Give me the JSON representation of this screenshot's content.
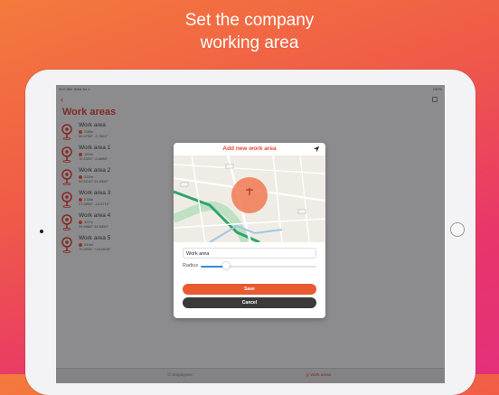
{
  "headline": {
    "line1": "Set the company",
    "line2": "working area"
  },
  "status_bar": {
    "time": "9:07 AM",
    "date": "Wed Jul 1",
    "battery": "100%"
  },
  "nav": {
    "back_glyph": "‹",
    "title": "Work areas"
  },
  "work_areas": [
    {
      "name": "Work area",
      "radius": "208m",
      "coords": "50.4758° -2.7824°"
    },
    {
      "name": "Work area 1",
      "radius": "150m",
      "coords": "12.6339° -0.6886°"
    },
    {
      "name": "Work area 2",
      "radius": "223m",
      "coords": "50.6215° 34.8955°"
    },
    {
      "name": "Work area 3",
      "radius": "218m",
      "coords": "27.8854° -15.5710°"
    },
    {
      "name": "Work area 4",
      "radius": "407m",
      "coords": "34.9968° 34.8959°"
    },
    {
      "name": "Work area 5",
      "radius": "243m",
      "coords": "70.3938° +43.0508°"
    }
  ],
  "tabbar": {
    "tab1": "Employees",
    "tab2": "Work areas"
  },
  "modal": {
    "title": "Add new work area",
    "name_value": "Work area",
    "radius_label": "Radius",
    "radius_fraction": 0.22,
    "save_label": "Save",
    "cancel_label": "Cancel"
  },
  "colors": {
    "accent": "#e44b33",
    "brand_dark": "#7e2a22",
    "cancel": "#3a3a3a"
  }
}
